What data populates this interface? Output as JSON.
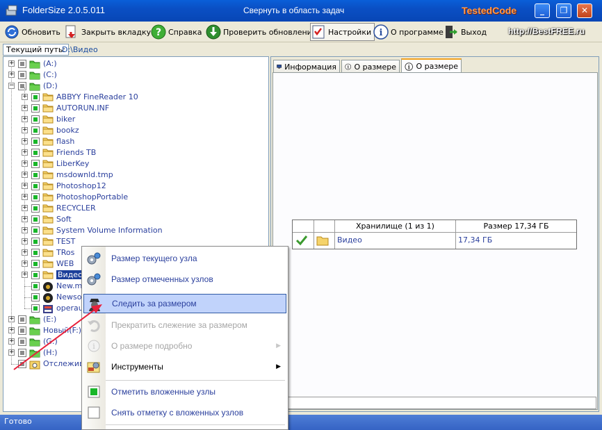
{
  "titlebar": {
    "app_title": "FolderSize 2.0.5.011",
    "window_title": "Свернуть в область задач",
    "brand": "TestedCode",
    "minimize": "_",
    "maximize": "❐",
    "close": "✕"
  },
  "toolbar": {
    "items": [
      {
        "label": "Обновить",
        "icon": "refresh-icon"
      },
      {
        "label": "Закрыть вкладку",
        "icon": "close-tab-icon"
      },
      {
        "label": "Справка",
        "icon": "help-icon"
      },
      {
        "label": "Проверить обновление",
        "icon": "update-icon"
      },
      {
        "label": "Настройки",
        "icon": "settings-icon"
      },
      {
        "label": "О программе",
        "icon": "info-icon"
      },
      {
        "label": "Выход",
        "icon": "exit-icon"
      }
    ],
    "watermark": "http://BestFREE.ru"
  },
  "path": {
    "label": "Текущий путь:",
    "value": "D:\\Видео"
  },
  "tree": {
    "drives_top": [
      {
        "label": "(A:)"
      },
      {
        "label": "(C:)"
      },
      {
        "label": "(D:)"
      }
    ],
    "d_children": [
      "ABBYY FineReader 10",
      "AUTORUN.INF",
      "biker",
      "bookz",
      "flash",
      "Friends TB",
      "LiberKey",
      "msdownld.tmp",
      "Photoshop12",
      "PhotoshopPortable",
      "RECYCLER",
      "Soft",
      "System Volume Information",
      "TEST",
      "TRos",
      "WEB",
      "Видео",
      "New.m",
      "Newso",
      "operau"
    ],
    "drives_bottom": [
      {
        "label": "(E:)"
      },
      {
        "label": "Новый(F:)"
      },
      {
        "label": "(G:)"
      },
      {
        "label": "(H:)"
      },
      {
        "label": "Отслежив"
      }
    ]
  },
  "tabs": [
    {
      "label": "Информация",
      "icon": "computer-icon"
    },
    {
      "label": "О размере",
      "icon": "info-icon"
    },
    {
      "label": "О размере",
      "icon": "info-icon",
      "active": true
    }
  ],
  "folder_table": {
    "header_storage": "Хранилище (1 из 1)",
    "header_size": "Размер 17,34 ГБ",
    "row": {
      "name": "Видео",
      "size": "17,34 ГБ"
    }
  },
  "context_menu": {
    "items": [
      {
        "label": "Размер текущего узла",
        "state": "normal"
      },
      {
        "label": "Размер отмеченных узлов",
        "state": "normal"
      },
      {
        "label": "Следить за размером",
        "state": "highlighted"
      },
      {
        "label": "Прекратить слежение за размером",
        "state": "disabled"
      },
      {
        "label": "О размере подробно",
        "state": "disabled"
      },
      {
        "label": "Инструменты",
        "state": "normal"
      },
      {
        "label": "Отметить вложенные узлы",
        "state": "normal"
      },
      {
        "label": "Снять отметку с вложенных узлов",
        "state": "normal"
      }
    ]
  },
  "status": {
    "text": "Готово"
  },
  "colors": {
    "titlebar": "#0a5fd8",
    "status": "#3f6fd0",
    "link_text": "#2a3f9d",
    "highlight": "#c1d3fb",
    "annotation_arrow": "#e8203a"
  }
}
